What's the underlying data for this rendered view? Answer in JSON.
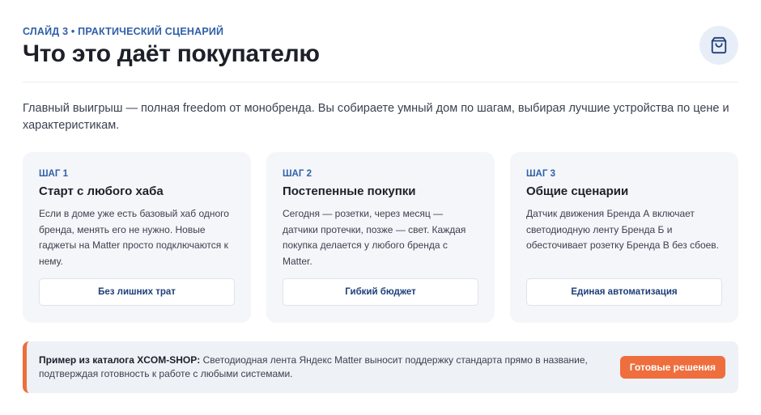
{
  "header": {
    "eyebrow": "СЛАЙД 3 • ПРАКТИЧЕСКИЙ СЦЕНАРИЙ",
    "title": "Что это даёт покупателю",
    "icon": "shopping-bag-icon"
  },
  "intro": "Главный выигрыш — полная freedom от монобренда. Вы собираете умный дом по шагам, выбирая лучшие устройства по цене и характеристикам.",
  "cards": [
    {
      "step": "ШАГ 1",
      "title": "Старт с любого хаба",
      "text": "Если в доме уже есть базовый хаб одного бренда, менять его не нужно. Новые гаджеты на Matter просто подключаются к нему.",
      "button": "Без лишних трат"
    },
    {
      "step": "ШАГ 2",
      "title": "Постепенные покупки",
      "text": "Сегодня — розетки, через месяц — датчики протечки, позже — свет. Каждая покупка делается у любого бренда с Matter.",
      "button": "Гибкий бюджет"
    },
    {
      "step": "ШАГ 3",
      "title": "Общие сценарии",
      "text": "Датчик движения Бренда А включает светодиодную ленту Бренда Б и обесточивает розетку Бренда В без сбоев.",
      "button": "Единая автоматизация"
    }
  ],
  "callout": {
    "lead": "Пример из каталога XCOM-SHOP:",
    "text": " Светодиодная лента Яндекс Matter выносит поддержку стандарта прямо в название, подтверждая готовность к работе с любыми системами.",
    "button": "Готовые решения"
  },
  "colors": {
    "accent_blue": "#2f5fa8",
    "accent_orange": "#ee6e3d",
    "card_bg": "#f4f6f9"
  }
}
